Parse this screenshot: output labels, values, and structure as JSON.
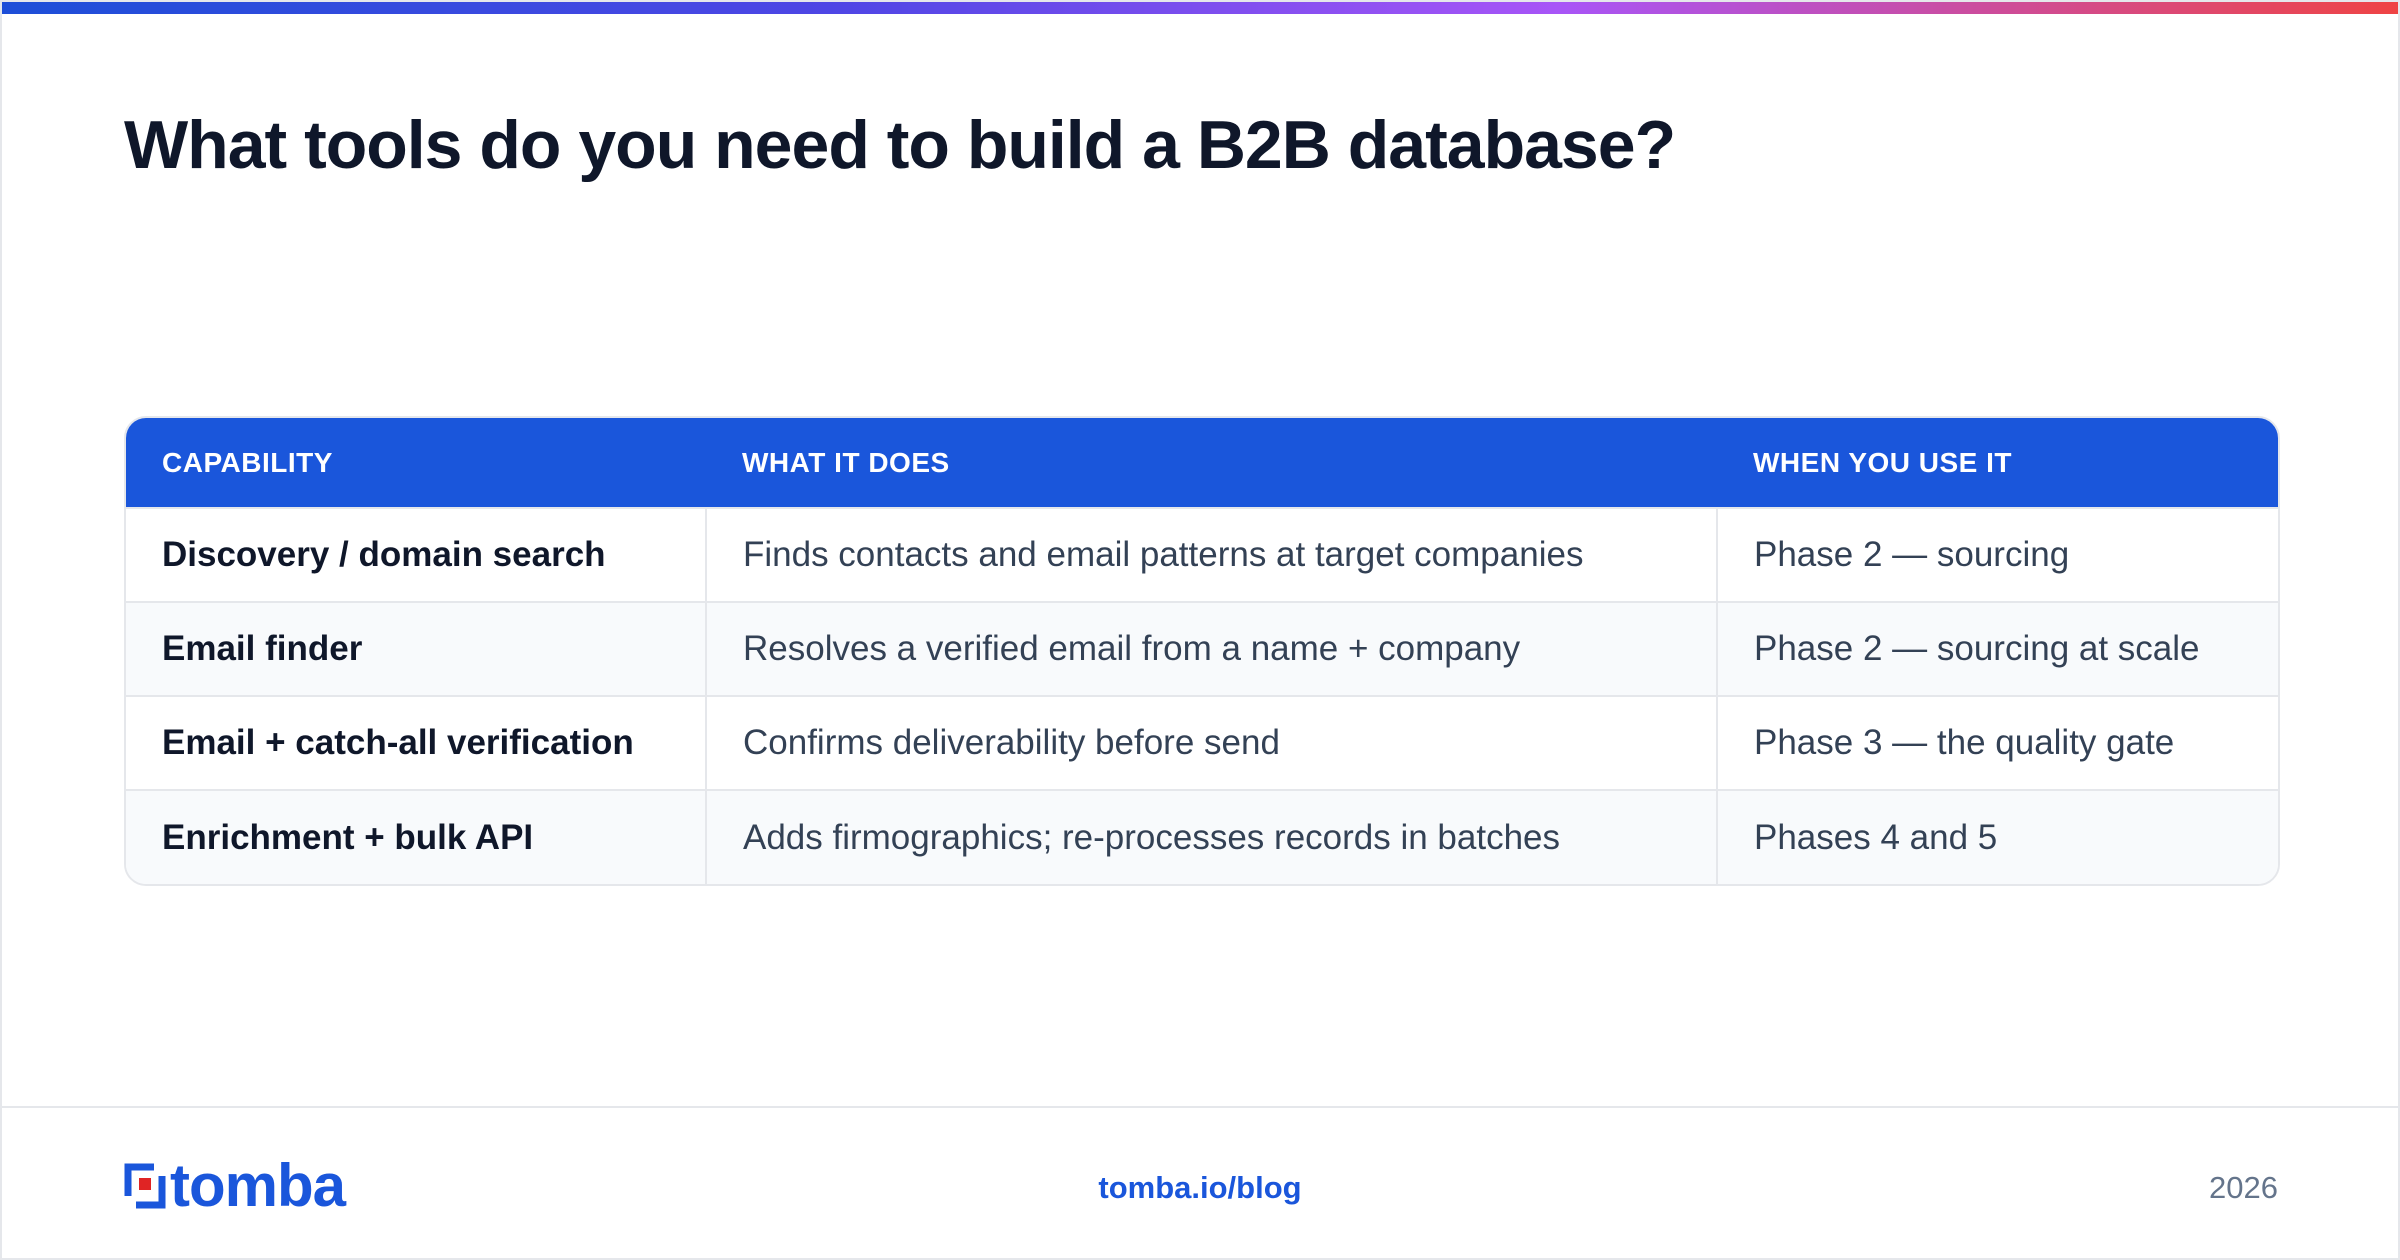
{
  "page": {
    "title": "What tools do you need to build a B2B database?"
  },
  "table": {
    "headers": [
      "CAPABILITY",
      "WHAT IT DOES",
      "WHEN YOU USE IT"
    ],
    "rows": [
      [
        "Discovery / domain search",
        "Finds contacts and email patterns at target companies",
        "Phase 2 — sourcing"
      ],
      [
        "Email finder",
        "Resolves a verified email from a name + company",
        "Phase 2 — sourcing at scale"
      ],
      [
        "Email + catch-all verification",
        "Confirms deliverability before send",
        "Phase 3 — the quality gate"
      ],
      [
        "Enrichment + bulk API",
        "Adds firmographics; re-processes records in batches",
        "Phases 4 and 5"
      ]
    ]
  },
  "footer": {
    "logo_text": "tomba",
    "link": "tomba.io/blog",
    "year": "2026"
  },
  "colors": {
    "brand_blue": "#1a56db",
    "logo_accent_red": "#e02424",
    "title_text": "#0f172a"
  },
  "icons": {
    "logo_mark": "tomba-logo-icon"
  }
}
